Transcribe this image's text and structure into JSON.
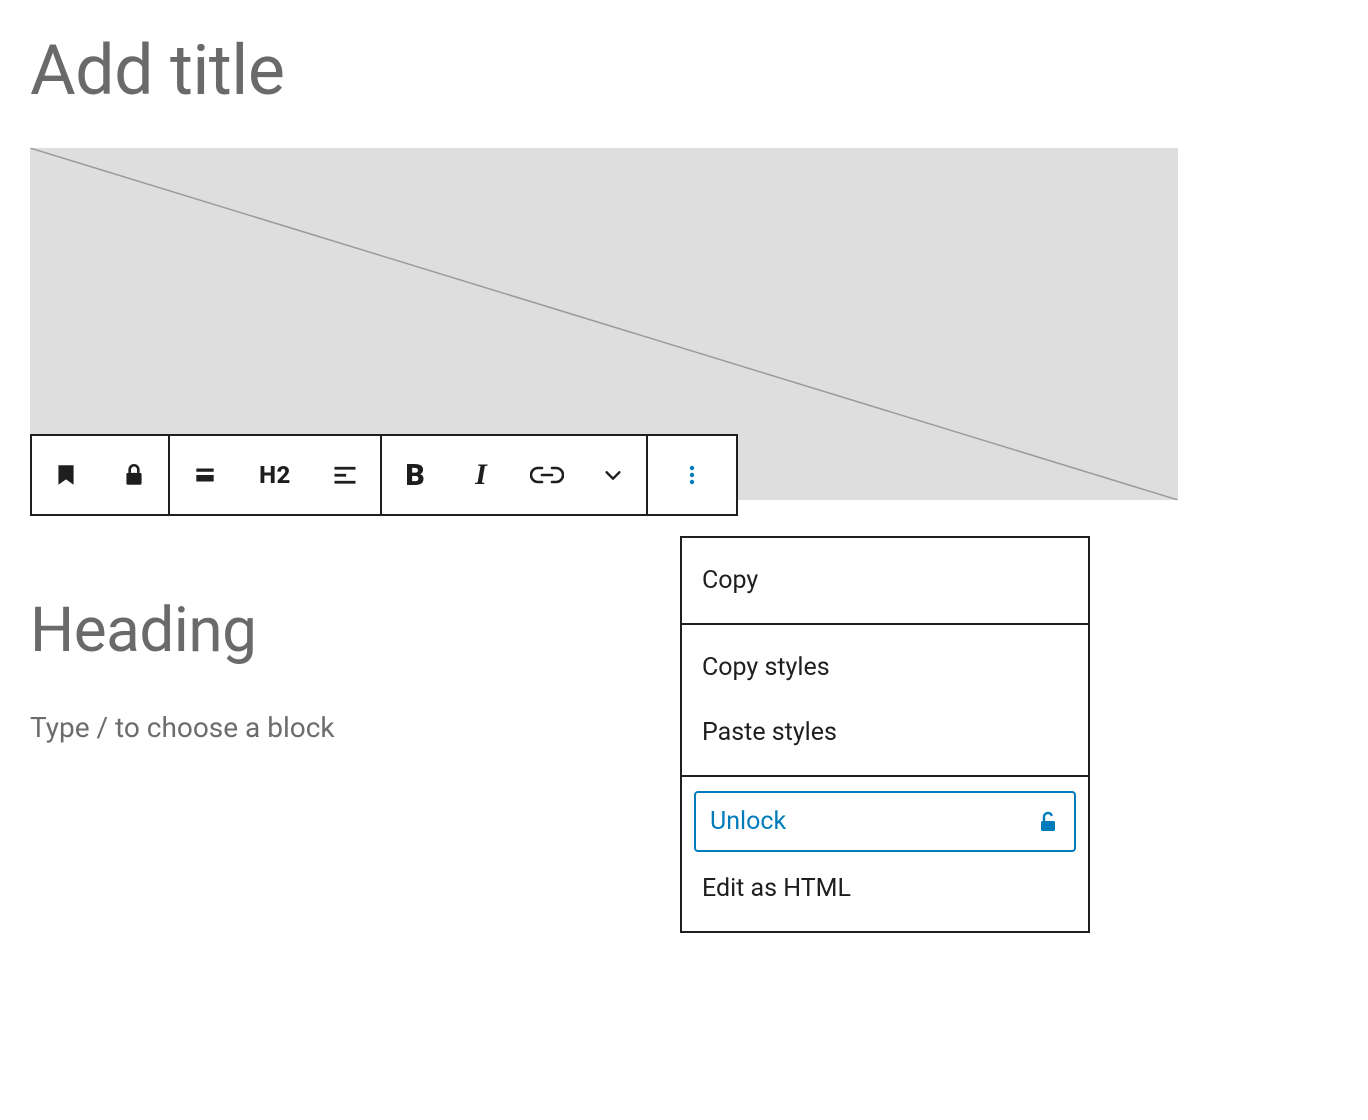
{
  "title": {
    "placeholder": "Add title"
  },
  "toolbar": {
    "heading_level": "H2"
  },
  "heading": {
    "placeholder": "Heading"
  },
  "paragraph": {
    "placeholder": "Type / to choose a block"
  },
  "menu": {
    "copy": "Copy",
    "copy_styles": "Copy styles",
    "paste_styles": "Paste styles",
    "unlock": "Unlock",
    "edit_html": "Edit as HTML"
  },
  "colors": {
    "accent": "#007cba",
    "muted_text": "#6a6a6a",
    "border": "#1e1e1e",
    "placeholder_bg": "#dedede"
  }
}
